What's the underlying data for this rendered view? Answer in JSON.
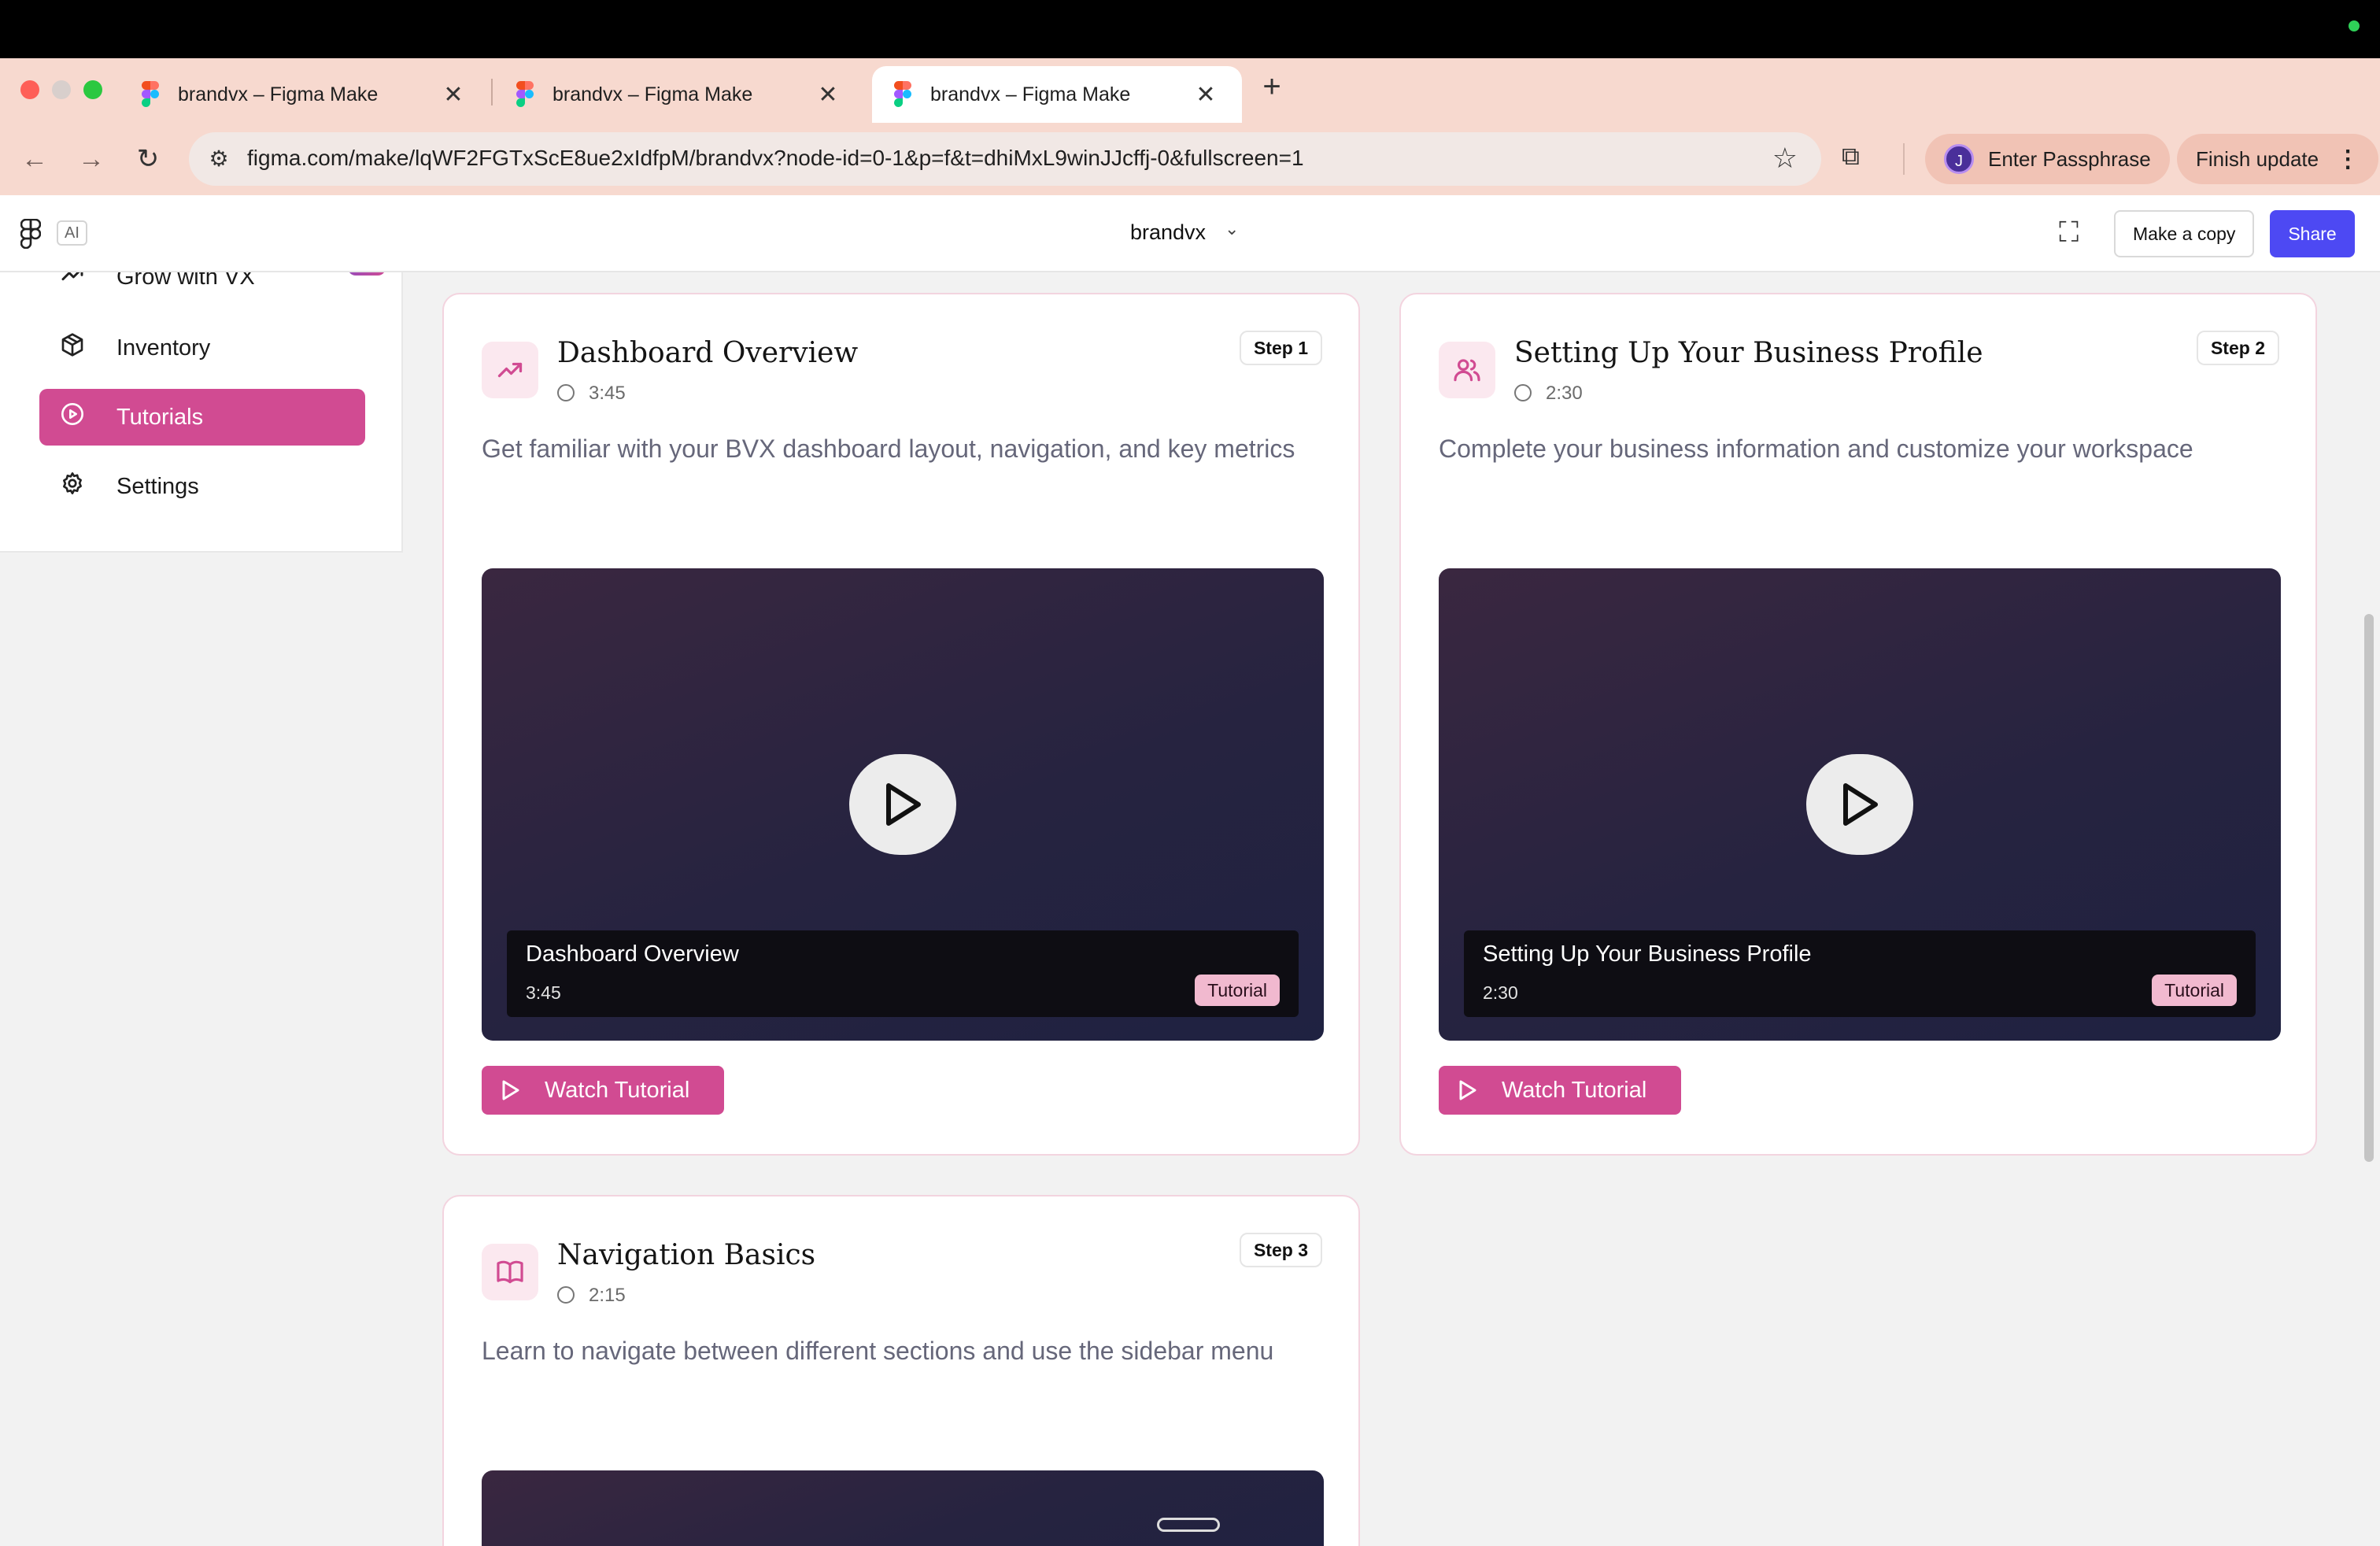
{
  "browser": {
    "tabs": [
      {
        "title": "brandvx – Figma Make"
      },
      {
        "title": "brandvx – Figma Make"
      },
      {
        "title": "brandvx – Figma Make"
      }
    ],
    "url": "figma.com/make/lqWF2FGTxScE8ue2xIdfpM/brandvx?node-id=0-1&p=f&t=dhiMxL9winJJcffj-0&fullscreen=1",
    "profile_initial": "J",
    "passphrase_label": "Enter Passphrase",
    "update_label": "Finish update"
  },
  "figma": {
    "ai_label": "AI",
    "file_name": "brandvx",
    "copy_label": "Make a copy",
    "share_label": "Share"
  },
  "sidebar": {
    "items": [
      {
        "label": "Grow with VX",
        "icon": "trending-up-icon"
      },
      {
        "label": "Inventory",
        "icon": "box-icon"
      },
      {
        "label": "Tutorials",
        "icon": "play-circle-icon",
        "active": true
      },
      {
        "label": "Settings",
        "icon": "gear-icon"
      }
    ]
  },
  "tutorials": [
    {
      "title": "Dashboard Overview",
      "duration": "3:45",
      "step": "Step 1",
      "description": "Get familiar with your BVX dashboard layout, navigation, and key metrics",
      "video_title": "Dashboard Overview",
      "video_duration": "3:45",
      "tag": "Tutorial",
      "button": "Watch Tutorial",
      "icon": "trending-up-icon"
    },
    {
      "title": "Setting Up Your Business Profile",
      "duration": "2:30",
      "step": "Step 2",
      "description": "Complete your business information and customize your workspace",
      "video_title": "Setting Up Your Business Profile",
      "video_duration": "2:30",
      "tag": "Tutorial",
      "button": "Watch Tutorial",
      "icon": "users-icon"
    },
    {
      "title": "Navigation Basics",
      "duration": "2:15",
      "step": "Step 3",
      "description": "Learn to navigate between different sections and use the sidebar menu",
      "icon": "book-icon"
    }
  ],
  "colors": {
    "accent": "#d14b92",
    "share": "#4d49f3",
    "chrome": "#f7d9cf"
  }
}
